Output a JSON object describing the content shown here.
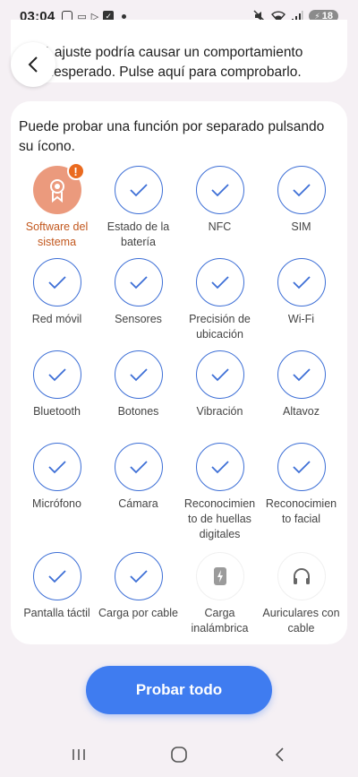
{
  "status_bar": {
    "time": "03:04",
    "battery": "18",
    "icons": [
      "screenshot-icon",
      "cast-icon",
      "play-icon",
      "check-icon",
      "dot-icon",
      "mute-icon",
      "wifi-icon",
      "signal-icon",
      "battery-icon"
    ]
  },
  "warning_card": {
    "text": "1 ajuste podría causar un comportamiento inesperado. Pulse aquí para comprobarlo."
  },
  "back_button": {
    "icon": "chevron-left-icon"
  },
  "tests": {
    "intro": "Puede probar una función por separado pulsando su ícono.",
    "items": [
      {
        "label": "Software del sistema",
        "status": "warning",
        "icon": "system-software-icon"
      },
      {
        "label": "Estado de la batería",
        "status": "passed",
        "icon": "check-icon"
      },
      {
        "label": "NFC",
        "status": "passed",
        "icon": "check-icon"
      },
      {
        "label": "SIM",
        "status": "passed",
        "icon": "check-icon"
      },
      {
        "label": "Red móvil",
        "status": "passed",
        "icon": "check-icon"
      },
      {
        "label": "Sensores",
        "status": "passed",
        "icon": "check-icon"
      },
      {
        "label": "Precisión de ubicación",
        "status": "passed",
        "icon": "check-icon"
      },
      {
        "label": "Wi-Fi",
        "status": "passed",
        "icon": "check-icon"
      },
      {
        "label": "Bluetooth",
        "status": "passed",
        "icon": "check-icon"
      },
      {
        "label": "Botones",
        "status": "passed",
        "icon": "check-icon"
      },
      {
        "label": "Vibración",
        "status": "passed",
        "icon": "check-icon"
      },
      {
        "label": "Altavoz",
        "status": "passed",
        "icon": "check-icon"
      },
      {
        "label": "Micrófono",
        "status": "passed",
        "icon": "check-icon"
      },
      {
        "label": "Cámara",
        "status": "passed",
        "icon": "check-icon"
      },
      {
        "label": "Reconocimien to de huellas digitales",
        "status": "passed",
        "icon": "check-icon"
      },
      {
        "label": "Reconocimien to facial",
        "status": "passed",
        "icon": "check-icon"
      },
      {
        "label": "Pantalla táctil",
        "status": "passed",
        "icon": "check-icon"
      },
      {
        "label": "Carga por cable",
        "status": "passed",
        "icon": "check-icon"
      },
      {
        "label": "Carga inalámbrica",
        "status": "pending",
        "icon": "wireless-charging-icon"
      },
      {
        "label": "Auriculares con cable",
        "status": "pending",
        "icon": "headphones-icon"
      }
    ]
  },
  "test_all_button": {
    "label": "Probar todo"
  },
  "nav_bar": {
    "icons": [
      "recent-apps-icon",
      "home-icon",
      "back-icon"
    ]
  },
  "colors": {
    "accent": "#3f7cf0",
    "check": "#3d6fd6",
    "warning_circle": "#eb9a7d",
    "warning_badge": "#ea6a1f",
    "warning_label": "#c2571d"
  }
}
